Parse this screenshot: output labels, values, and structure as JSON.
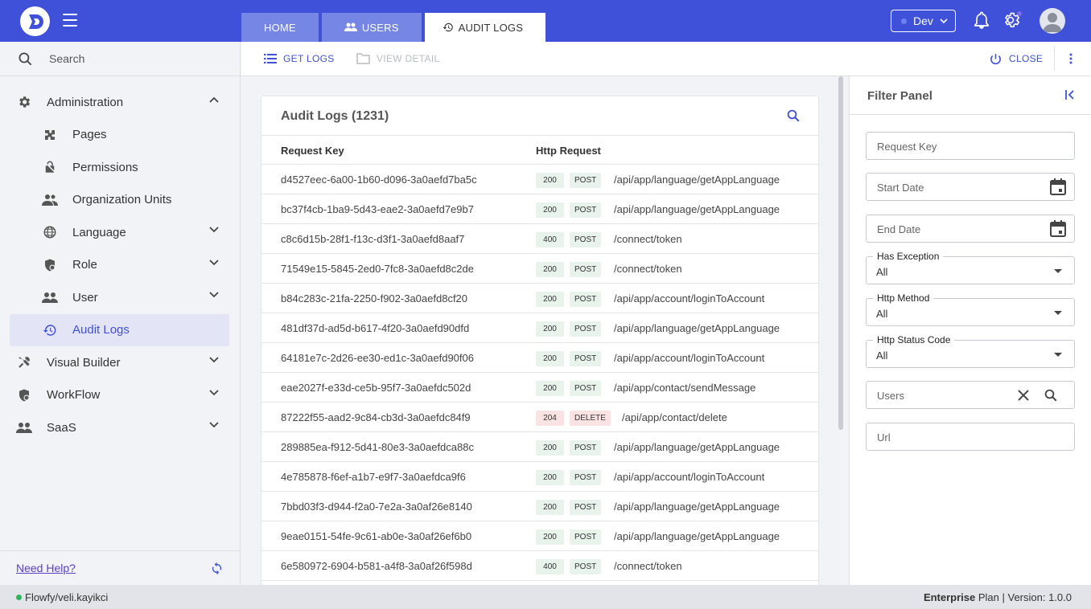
{
  "topbar": {
    "tabs": [
      {
        "label": "HOME",
        "icon": "home"
      },
      {
        "label": "USERS",
        "icon": "users-icon"
      },
      {
        "label": "AUDIT LOGS",
        "icon": "history-icon"
      }
    ],
    "env_label": "Dev",
    "colors": {
      "brand": "#3f51d8",
      "tab_inactive": "#7686e4"
    }
  },
  "sidebar": {
    "search_placeholder": "Search",
    "items": [
      {
        "label": "Administration",
        "icon": "gear-icon",
        "level": 1,
        "chevron": "up"
      },
      {
        "label": "Pages",
        "icon": "puzzle-icon",
        "level": 2
      },
      {
        "label": "Permissions",
        "icon": "lock-icon",
        "level": 2
      },
      {
        "label": "Organization Units",
        "icon": "group-icon",
        "level": 2
      },
      {
        "label": "Language",
        "icon": "globe-icon",
        "level": 2,
        "chevron": "down"
      },
      {
        "label": "Role",
        "icon": "role-icon",
        "level": 2,
        "chevron": "down"
      },
      {
        "label": "User",
        "icon": "people-icon",
        "level": 2,
        "chevron": "down"
      },
      {
        "label": "Audit Logs",
        "icon": "history-icon",
        "level": 2,
        "active": true
      },
      {
        "label": "Visual Builder",
        "icon": "tools-icon",
        "level": 1,
        "chevron": "down"
      },
      {
        "label": "WorkFlow",
        "icon": "workflow-icon",
        "level": 1,
        "chevron": "down"
      },
      {
        "label": "SaaS",
        "icon": "people-icon",
        "level": 1,
        "chevron": "down"
      }
    ],
    "help_label": "Need Help?"
  },
  "toolbar": {
    "get_logs": "GET LOGS",
    "view_detail": "VIEW DETAIL",
    "close": "CLOSE"
  },
  "card": {
    "title": "Audit Logs (1231)",
    "columns": [
      "Request Key",
      "Http Request"
    ],
    "rows": [
      {
        "key": "d4527eec-6a00-1b60-d096-3a0aefd7ba5c",
        "status": "200",
        "method": "POST",
        "url": "/api/app/language/getAppLanguage"
      },
      {
        "key": "bc37f4cb-1ba9-5d43-eae2-3a0aefd7e9b7",
        "status": "200",
        "method": "POST",
        "url": "/api/app/language/getAppLanguage"
      },
      {
        "key": "c8c6d15b-28f1-f13c-d3f1-3a0aefd8aaf7",
        "status": "400",
        "method": "POST",
        "url": "/connect/token"
      },
      {
        "key": "71549e15-5845-2ed0-7fc8-3a0aefd8c2de",
        "status": "200",
        "method": "POST",
        "url": "/connect/token"
      },
      {
        "key": "b84c283c-21fa-2250-f902-3a0aefd8cf20",
        "status": "200",
        "method": "POST",
        "url": "/api/app/account/loginToAccount"
      },
      {
        "key": "481df37d-ad5d-b617-4f20-3a0aefd90dfd",
        "status": "200",
        "method": "POST",
        "url": "/api/app/language/getAppLanguage"
      },
      {
        "key": "64181e7c-2d26-ee30-ed1c-3a0aefd90f06",
        "status": "200",
        "method": "POST",
        "url": "/api/app/account/loginToAccount"
      },
      {
        "key": "eae2027f-e33d-ce5b-95f7-3a0aefdc502d",
        "status": "200",
        "method": "POST",
        "url": "/api/app/contact/sendMessage"
      },
      {
        "key": "87222f55-aad2-9c84-cb3d-3a0aefdc84f9",
        "status": "204",
        "method": "DELETE",
        "url": "/api/app/contact/delete"
      },
      {
        "key": "289885ea-f912-5d41-80e3-3a0aefdca88c",
        "status": "200",
        "method": "POST",
        "url": "/api/app/language/getAppLanguage"
      },
      {
        "key": "4e785878-f6ef-a1b7-e9f7-3a0aefdca9f6",
        "status": "200",
        "method": "POST",
        "url": "/api/app/account/loginToAccount"
      },
      {
        "key": "7bbd03f3-d944-f2a0-7e2a-3a0af26e8140",
        "status": "200",
        "method": "POST",
        "url": "/api/app/language/getAppLanguage"
      },
      {
        "key": "9eae0151-54fe-9c61-ab0e-3a0af26ef6b0",
        "status": "200",
        "method": "POST",
        "url": "/api/app/language/getAppLanguage"
      },
      {
        "key": "6e580972-6904-b581-a4f8-3a0af26f598d",
        "status": "400",
        "method": "POST",
        "url": "/connect/token"
      }
    ]
  },
  "filter": {
    "title": "Filter Panel",
    "request_key": "Request Key",
    "start_date": "Start Date",
    "end_date": "End Date",
    "has_exception": {
      "label": "Has Exception",
      "value": "All"
    },
    "http_method": {
      "label": "Http Method",
      "value": "All"
    },
    "http_status": {
      "label": "Http Status Code",
      "value": "All"
    },
    "users": "Users",
    "url": "Url"
  },
  "statusbar": {
    "user": "Flowfy/veli.kayikci",
    "plan_bold": "Enterprise",
    "plan_rest": "Plan | Version: 1.0.0"
  }
}
